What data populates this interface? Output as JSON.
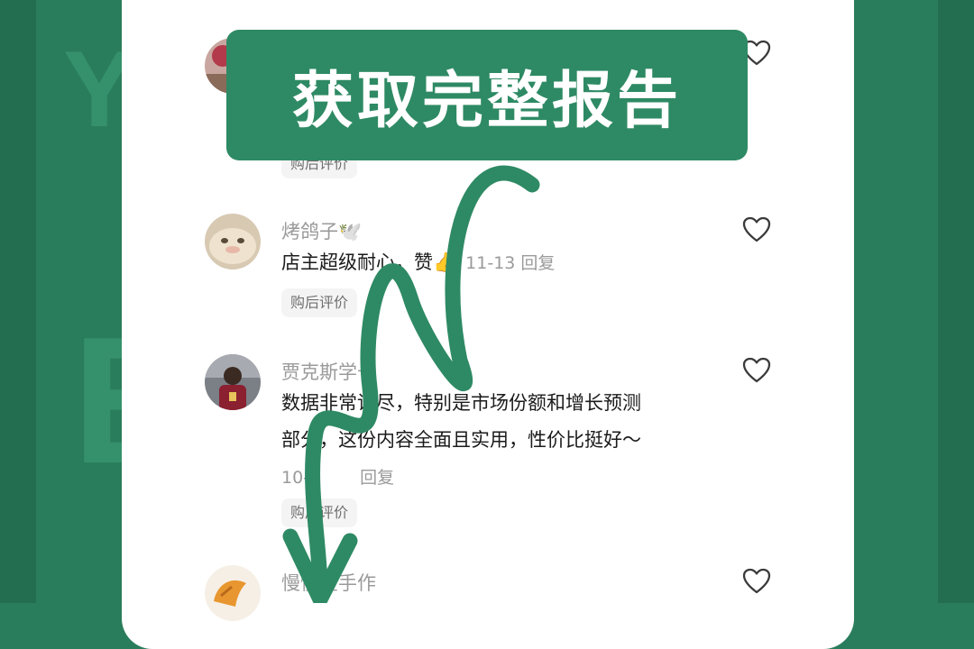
{
  "banner": {
    "label": "获取完整报告"
  },
  "comments": [
    {
      "username": "",
      "text": "",
      "tag": "购后评价"
    },
    {
      "username": "烤鸽子🕊️",
      "text": "店主超级耐心，赞👍",
      "meta": "11-13 回复",
      "tag": "购后评价"
    },
    {
      "username": "贾克斯学长",
      "text_line1": "数据非常详尽，特别是市场份额和增长预测",
      "text_line2": "部分，这份内容全面且实用，性价比挺好～",
      "meta": "10-2",
      "meta_reply": "回复",
      "tag": "购后评价"
    },
    {
      "username": "慢慢星手作"
    }
  ],
  "colors": {
    "brand_green": "#2e8a64",
    "background": "#2a7d5c",
    "card": "#ffffff",
    "muted_text": "#9a9a9a"
  },
  "icons": {
    "like": "heart-outline-icon",
    "arrow": "curly-down-arrow-icon"
  }
}
